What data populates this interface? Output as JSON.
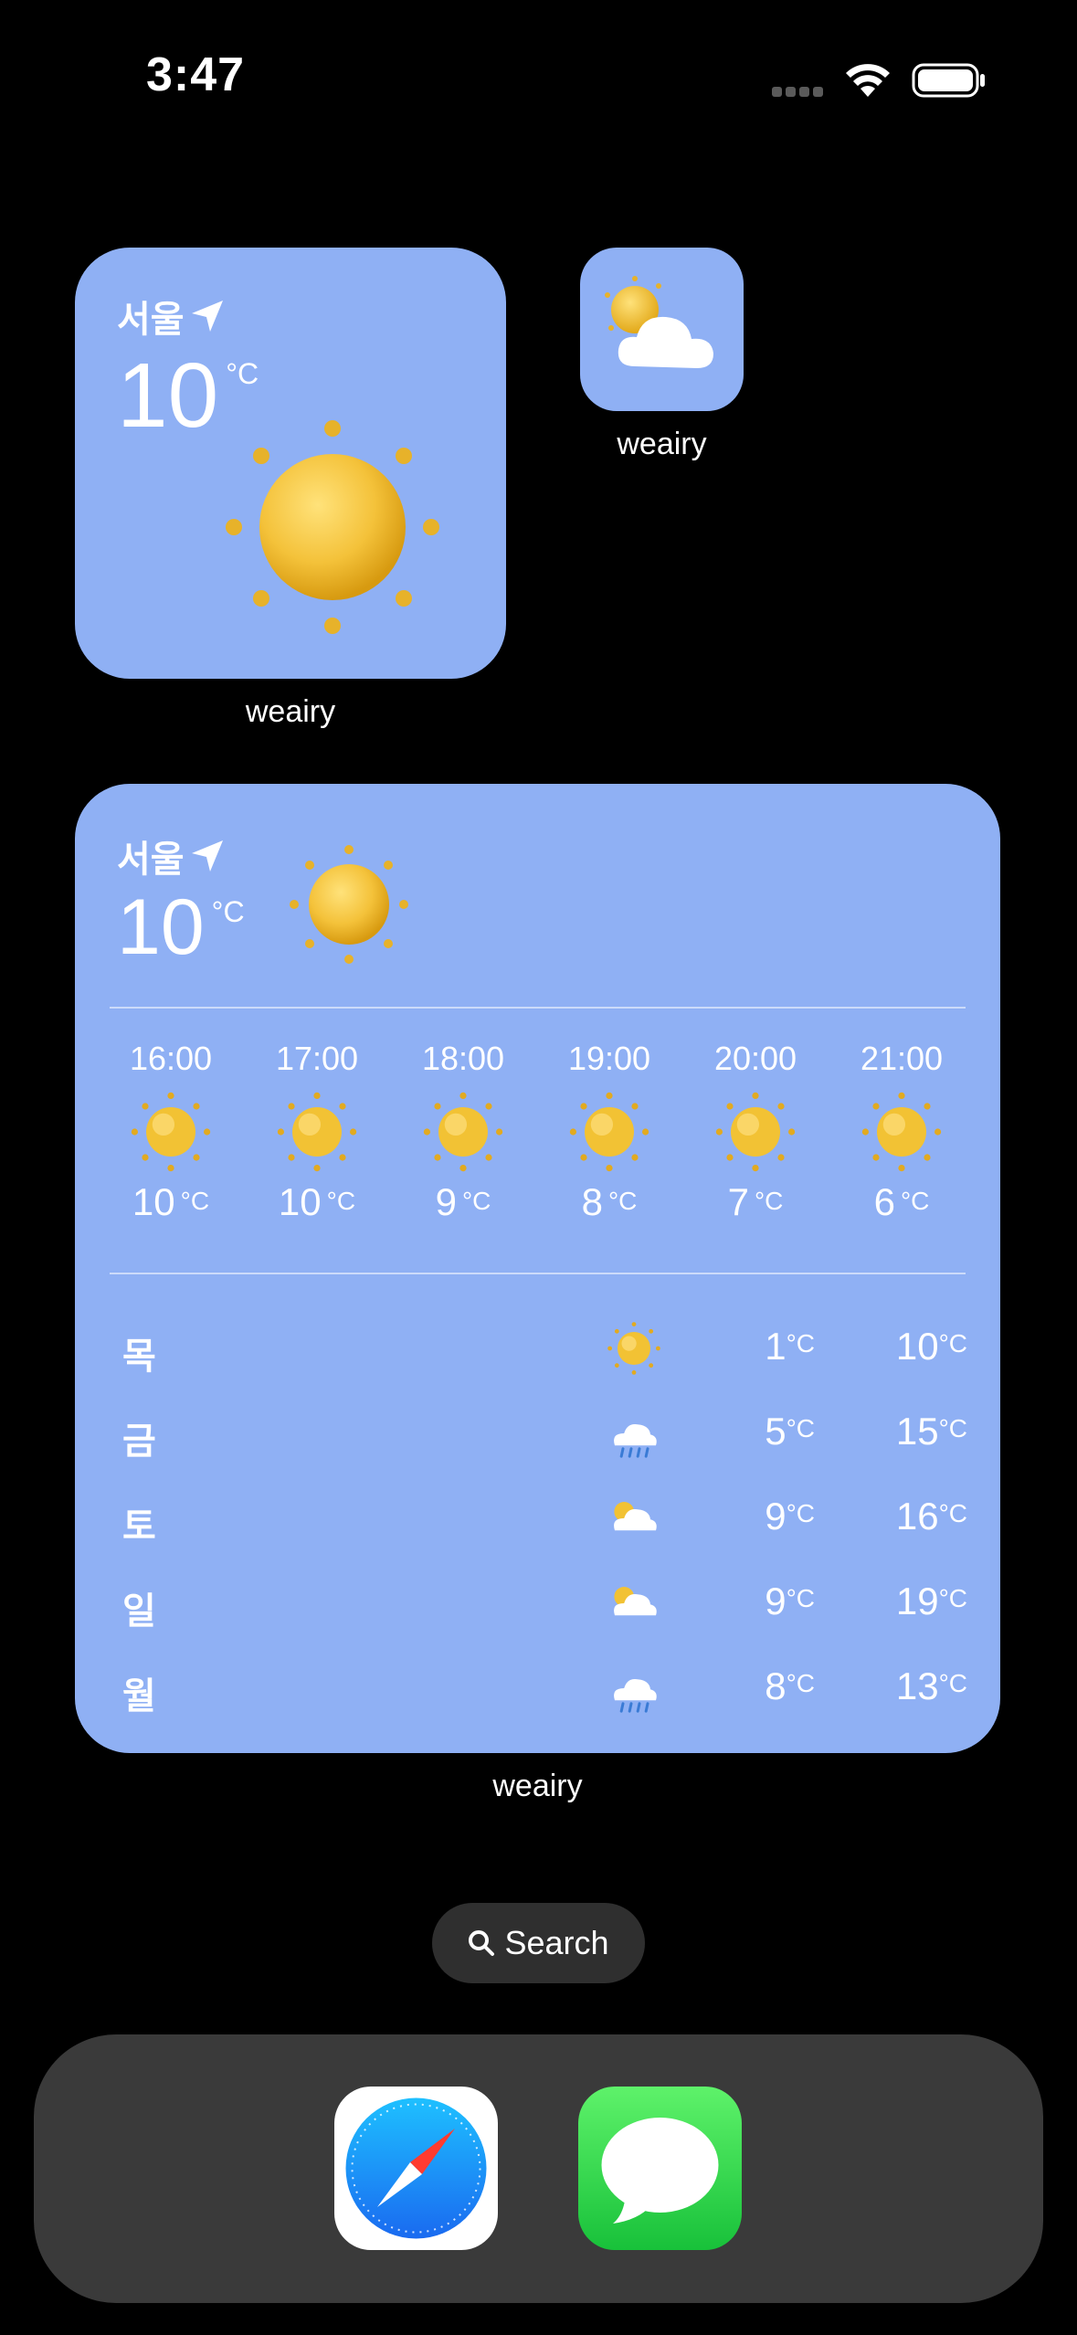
{
  "status_bar": {
    "time": "3:47"
  },
  "widget_small": {
    "city": "서울",
    "temperature": "10",
    "unit": "°C",
    "icon": "sun-icon",
    "app_label": "weairy"
  },
  "widget_app_icon": {
    "icon": "partly-cloudy-icon",
    "app_label": "weairy"
  },
  "widget_medium": {
    "city": "서울",
    "temperature": "10",
    "unit": "°C",
    "icon": "sun-icon",
    "app_label": "weairy",
    "hourly": [
      {
        "time": "16:00",
        "temp": "10",
        "unit": "°C",
        "icon": "sun-icon"
      },
      {
        "time": "17:00",
        "temp": "10",
        "unit": "°C",
        "icon": "sun-icon"
      },
      {
        "time": "18:00",
        "temp": "9",
        "unit": "°C",
        "icon": "sun-icon"
      },
      {
        "time": "19:00",
        "temp": "8",
        "unit": "°C",
        "icon": "sun-icon"
      },
      {
        "time": "20:00",
        "temp": "7",
        "unit": "°C",
        "icon": "sun-icon"
      },
      {
        "time": "21:00",
        "temp": "6",
        "unit": "°C",
        "icon": "sun-icon"
      }
    ],
    "daily": [
      {
        "day": "목",
        "icon": "sun-icon",
        "low": "1",
        "high": "10",
        "unit": "°C"
      },
      {
        "day": "금",
        "icon": "rain-cloud-icon",
        "low": "5",
        "high": "15",
        "unit": "°C"
      },
      {
        "day": "토",
        "icon": "partly-cloudy-icon",
        "low": "9",
        "high": "16",
        "unit": "°C"
      },
      {
        "day": "일",
        "icon": "partly-cloudy-icon",
        "low": "9",
        "high": "19",
        "unit": "°C"
      },
      {
        "day": "월",
        "icon": "rain-cloud-icon",
        "low": "8",
        "high": "13",
        "unit": "°C"
      }
    ]
  },
  "search": {
    "label": "Search"
  },
  "dock": [
    {
      "name": "safari-icon"
    },
    {
      "name": "messages-icon"
    }
  ],
  "colors": {
    "widget_bg": "#8fb0f4",
    "dock_bg": "#3a3a3a",
    "search_bg": "#2f2f2f"
  }
}
